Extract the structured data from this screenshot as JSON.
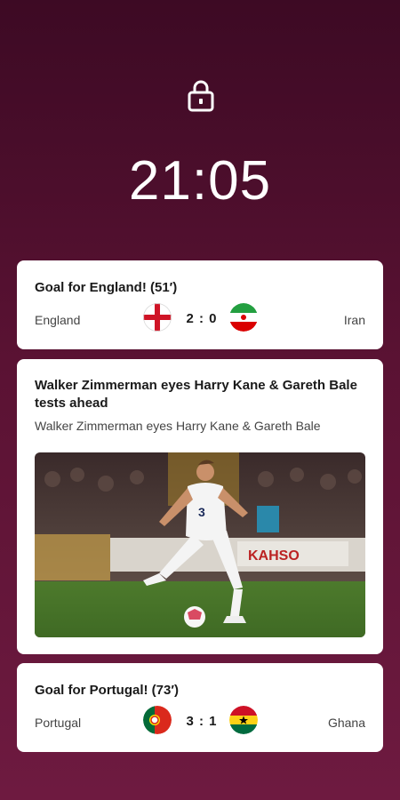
{
  "lockscreen": {
    "time": "21:05"
  },
  "notifications": [
    {
      "title": "Goal for England! (51′)",
      "home_team": "England",
      "away_team": "Iran",
      "score": "2 : 0",
      "home_flag": "england-flag-icon",
      "away_flag": "iran-flag-icon"
    },
    {
      "title": "Walker Zimmerman eyes Harry Kane & Gareth Bale tests ahead",
      "subtitle": "Walker Zimmerman eyes Harry Kane & Gareth Bale"
    },
    {
      "title": "Goal for Portugal! (73′)",
      "home_team": "Portugal",
      "away_team": "Ghana",
      "score": "3 : 1",
      "home_flag": "portugal-flag-icon",
      "away_flag": "ghana-flag-icon"
    }
  ],
  "colors": {
    "background_top": "#3d0a24",
    "background_bottom": "#6e1a40",
    "card": "#ffffff"
  }
}
